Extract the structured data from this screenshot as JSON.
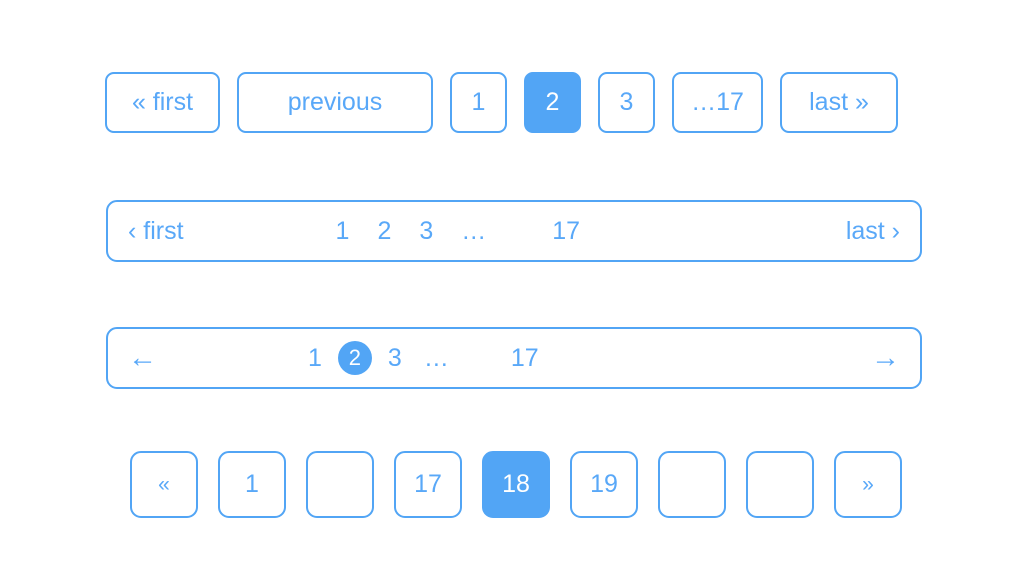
{
  "colors": {
    "accent": "#52a5f5",
    "text": "#59a8f8",
    "active_text": "#ffffff",
    "background": "#ffffff"
  },
  "pagination_variants": [
    {
      "name": "boxed-labelled",
      "style": "separate-boxes",
      "items": [
        {
          "label": "« first",
          "kind": "first",
          "active": false
        },
        {
          "label": "previous",
          "kind": "previous",
          "active": false
        },
        {
          "label": "1",
          "kind": "page",
          "active": false
        },
        {
          "label": "2",
          "kind": "page",
          "active": true
        },
        {
          "label": "3",
          "kind": "page",
          "active": false
        },
        {
          "label": "…17",
          "kind": "ellipsis-page",
          "active": false
        },
        {
          "label": "last »",
          "kind": "last",
          "active": false
        }
      ]
    },
    {
      "name": "bar-chevron-text",
      "style": "single-bar",
      "left_label": "‹ first",
      "right_label": "last ›",
      "pages": [
        {
          "label": "1",
          "active": false
        },
        {
          "label": "2",
          "active": false
        },
        {
          "label": "3",
          "active": false
        },
        {
          "label": "…",
          "active": false
        },
        {
          "label": "17",
          "active": false
        }
      ]
    },
    {
      "name": "bar-arrows",
      "style": "single-bar",
      "left_icon": "arrow-left-icon",
      "left_glyph": "←",
      "right_icon": "arrow-right-icon",
      "right_glyph": "→",
      "pages": [
        {
          "label": "1",
          "active": false
        },
        {
          "label": "2",
          "active": true
        },
        {
          "label": "3",
          "active": false
        },
        {
          "label": "…",
          "active": false
        },
        {
          "label": "17",
          "active": false
        }
      ]
    },
    {
      "name": "boxed-squares",
      "style": "separate-boxes",
      "items": [
        {
          "label": "«",
          "kind": "first",
          "active": false
        },
        {
          "label": "1",
          "kind": "page",
          "active": false
        },
        {
          "label": "",
          "kind": "blank",
          "active": false
        },
        {
          "label": "17",
          "kind": "page",
          "active": false
        },
        {
          "label": "18",
          "kind": "page",
          "active": true
        },
        {
          "label": "19",
          "kind": "page",
          "active": false
        },
        {
          "label": "",
          "kind": "blank",
          "active": false
        },
        {
          "label": "",
          "kind": "blank",
          "active": false
        },
        {
          "label": "»",
          "kind": "last",
          "active": false
        }
      ]
    }
  ]
}
